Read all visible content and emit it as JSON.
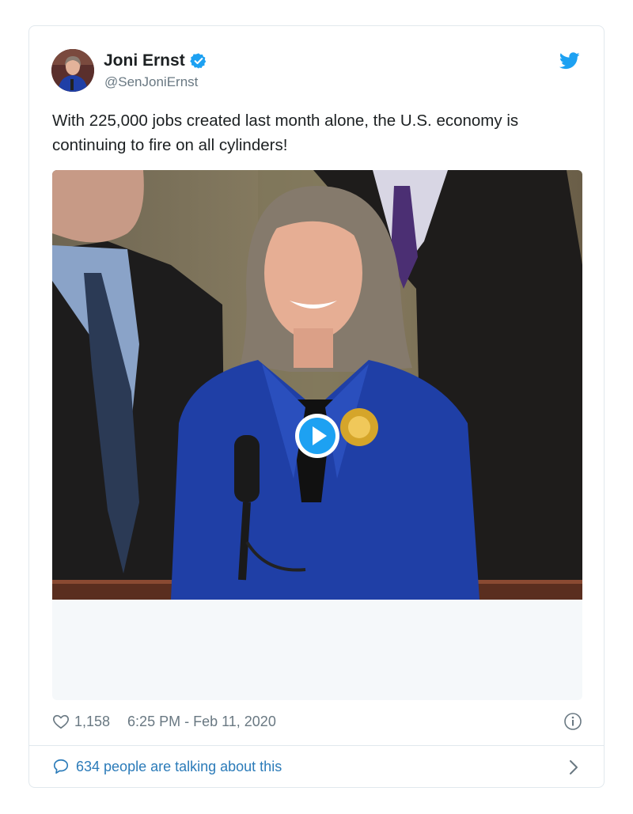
{
  "tweet": {
    "author_name": "Joni Ernst",
    "handle": "@SenJoniErnst",
    "text": "With 225,000 jobs created last month alone, the U.S. economy is continuing to fire on all cylinders!",
    "like_count": "1,158",
    "timestamp": "6:25 PM - Feb 11, 2020",
    "conversation_text": "634 people are talking about this",
    "icons": {
      "verified": "verified-badge-icon",
      "brand": "twitter-bird-icon",
      "like": "heart-icon",
      "info": "info-icon",
      "reply": "speech-bubble-icon",
      "more": "chevron-right-icon",
      "play": "play-icon"
    }
  },
  "colors": {
    "brand_blue": "#1da1f2",
    "link_blue": "#2b7bb9",
    "muted_text": "#697882",
    "border": "#e1e8ed",
    "blazer_blue": "#1f3fa6"
  }
}
